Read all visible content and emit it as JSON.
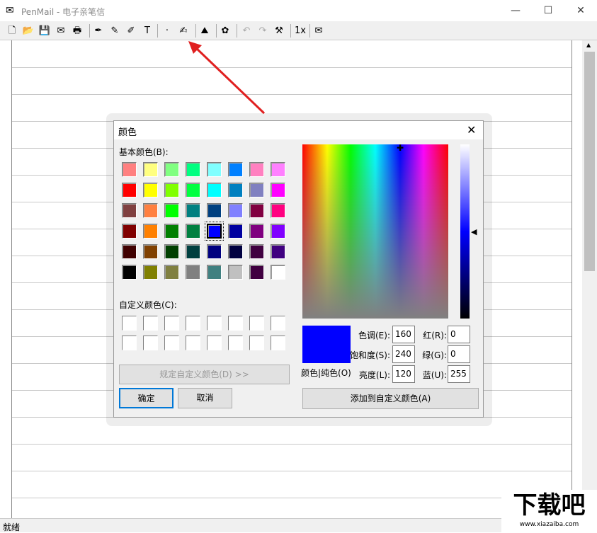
{
  "window": {
    "title": "PenMail - 电子亲笔信",
    "minimize": "—",
    "maximize": "☐",
    "close": "✕"
  },
  "toolbar": [
    {
      "name": "new-icon",
      "glyph": "🗋"
    },
    {
      "name": "open-icon",
      "glyph": "📂"
    },
    {
      "name": "save-icon",
      "glyph": "💾"
    },
    {
      "name": "envelope-icon",
      "glyph": "✉"
    },
    {
      "name": "print-icon",
      "glyph": "🖶"
    },
    {
      "name": "pen-icon",
      "glyph": "✒"
    },
    {
      "name": "marker-icon",
      "glyph": "✎"
    },
    {
      "name": "eraser-icon",
      "glyph": "✐"
    },
    {
      "name": "text-icon",
      "glyph": "T"
    },
    {
      "name": "pen-size-icon",
      "glyph": "·"
    },
    {
      "name": "pen-color-icon",
      "glyph": "✍"
    },
    {
      "name": "background-icon",
      "glyph": "⛰"
    },
    {
      "name": "stamp-flower-icon",
      "glyph": "✿"
    },
    {
      "name": "undo-icon",
      "glyph": "↶"
    },
    {
      "name": "redo-icon",
      "glyph": "↷"
    },
    {
      "name": "tools-icon",
      "glyph": "⚒"
    },
    {
      "name": "zoom-1x-icon",
      "glyph": "1x"
    },
    {
      "name": "send-mail-icon",
      "glyph": "✉"
    }
  ],
  "status": "就绪",
  "dialog": {
    "title": "颜色",
    "basic_label": "基本颜色(B):",
    "basic_colors": [
      "#FF8080",
      "#FFFF80",
      "#80FF80",
      "#00FF80",
      "#80FFFF",
      "#0080FF",
      "#FF80C0",
      "#FF80FF",
      "#FF0000",
      "#FFFF00",
      "#80FF00",
      "#00FF40",
      "#00FFFF",
      "#0080C0",
      "#8080C0",
      "#FF00FF",
      "#804040",
      "#FF8040",
      "#00FF00",
      "#008080",
      "#004080",
      "#8080FF",
      "#800040",
      "#FF0080",
      "#800000",
      "#FF8000",
      "#008000",
      "#008040",
      "#0000FF",
      "#0000A0",
      "#800080",
      "#8000FF",
      "#400000",
      "#804000",
      "#004000",
      "#004040",
      "#000080",
      "#000040",
      "#400040",
      "#400080",
      "#000000",
      "#808000",
      "#808040",
      "#808080",
      "#408080",
      "#C0C0C0",
      "#400040",
      "#FFFFFF"
    ],
    "selected_index": 28,
    "custom_label": "自定义颜色(C):",
    "define_custom": "规定自定义颜色(D) >>",
    "ok": "确定",
    "cancel": "取消",
    "preview_color": "#0000FF",
    "preview_label": "颜色|纯色(O)",
    "fields": {
      "hue_label": "色调(E):",
      "hue": "160",
      "sat_label": "饱和度(S):",
      "sat": "240",
      "lum_label": "亮度(L):",
      "lum": "120",
      "red_label": "红(R):",
      "red": "0",
      "green_label": "绿(G):",
      "green": "0",
      "blue_label": "蓝(U):",
      "blue": "255"
    },
    "add_custom": "添加到自定义颜色(A)"
  },
  "annotation_color": "#E02020",
  "watermark": {
    "text": "下载吧",
    "url": "www.xiazaiba.com"
  }
}
